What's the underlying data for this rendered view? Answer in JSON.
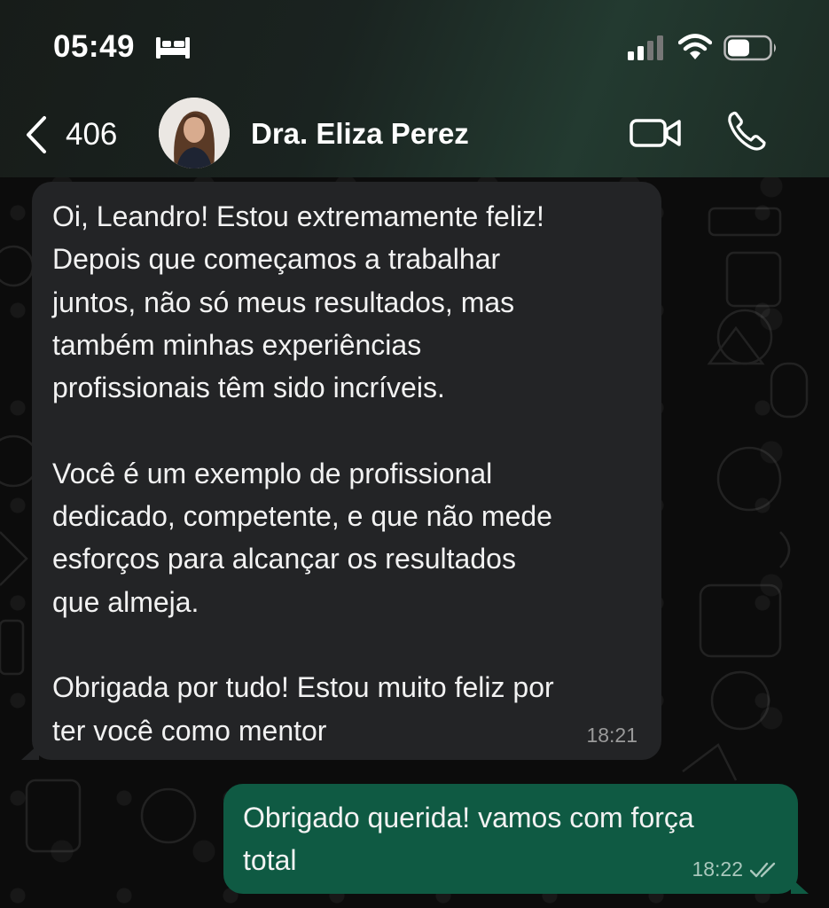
{
  "status_bar": {
    "time": "05:49",
    "icons": [
      "bed-icon",
      "signal-icon",
      "wifi-icon",
      "battery-icon"
    ]
  },
  "header": {
    "back_count": "406",
    "contact_name": "Dra. Eliza Perez",
    "icons": [
      "back-chevron-icon",
      "video-camera-icon",
      "phone-icon"
    ]
  },
  "messages": [
    {
      "direction": "incoming",
      "text": "Oi, Leandro! Estou extremamente feliz!\nDepois que começamos a trabalhar\njuntos, não só meus resultados, mas\ntambém minhas experiências\nprofissionais têm sido incríveis.\n\nVocê é um exemplo de profissional\ndedicado, competente, e que não mede\nesforços para alcançar os resultados\nque almeja.\n\nObrigada por tudo! Estou muito feliz por\nter você como mentor",
      "time": "18:21"
    },
    {
      "direction": "outgoing",
      "text": "Obrigado querida! vamos com força\ntotal",
      "time": "18:22",
      "status": "read"
    }
  ],
  "colors": {
    "incoming_bubble": "#232426",
    "outgoing_bubble": "#0f5a43",
    "header_accent": "#233a30"
  }
}
